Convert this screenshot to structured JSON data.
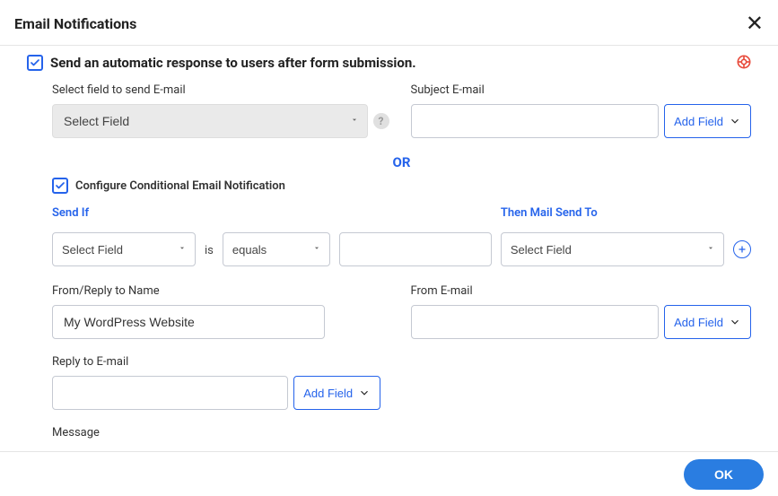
{
  "header": {
    "title": "Email Notifications"
  },
  "main_checkbox": {
    "label": "Send an automatic response to users after form submission."
  },
  "field_to_send": {
    "label": "Select field to send E-mail",
    "value": "Select Field"
  },
  "subject_email": {
    "label": "Subject E-mail",
    "value": "",
    "add_field_label": "Add Field"
  },
  "or_label": "OR",
  "conditional_checkbox": {
    "label": "Configure Conditional Email Notification"
  },
  "conditional": {
    "send_if_label": "Send If",
    "is_label": "is",
    "field_value": "Select Field",
    "operator_value": "equals",
    "value": "",
    "then_label": "Then Mail Send To",
    "then_value": "Select Field"
  },
  "from_reply_name": {
    "label": "From/Reply to Name",
    "value": "My WordPress Website"
  },
  "from_email": {
    "label": "From E-mail",
    "value": "",
    "add_field_label": "Add Field"
  },
  "reply_to_email": {
    "label": "Reply to E-mail",
    "value": "",
    "add_field_label": "Add Field"
  },
  "message": {
    "label": "Message"
  },
  "footer": {
    "ok_label": "OK"
  }
}
